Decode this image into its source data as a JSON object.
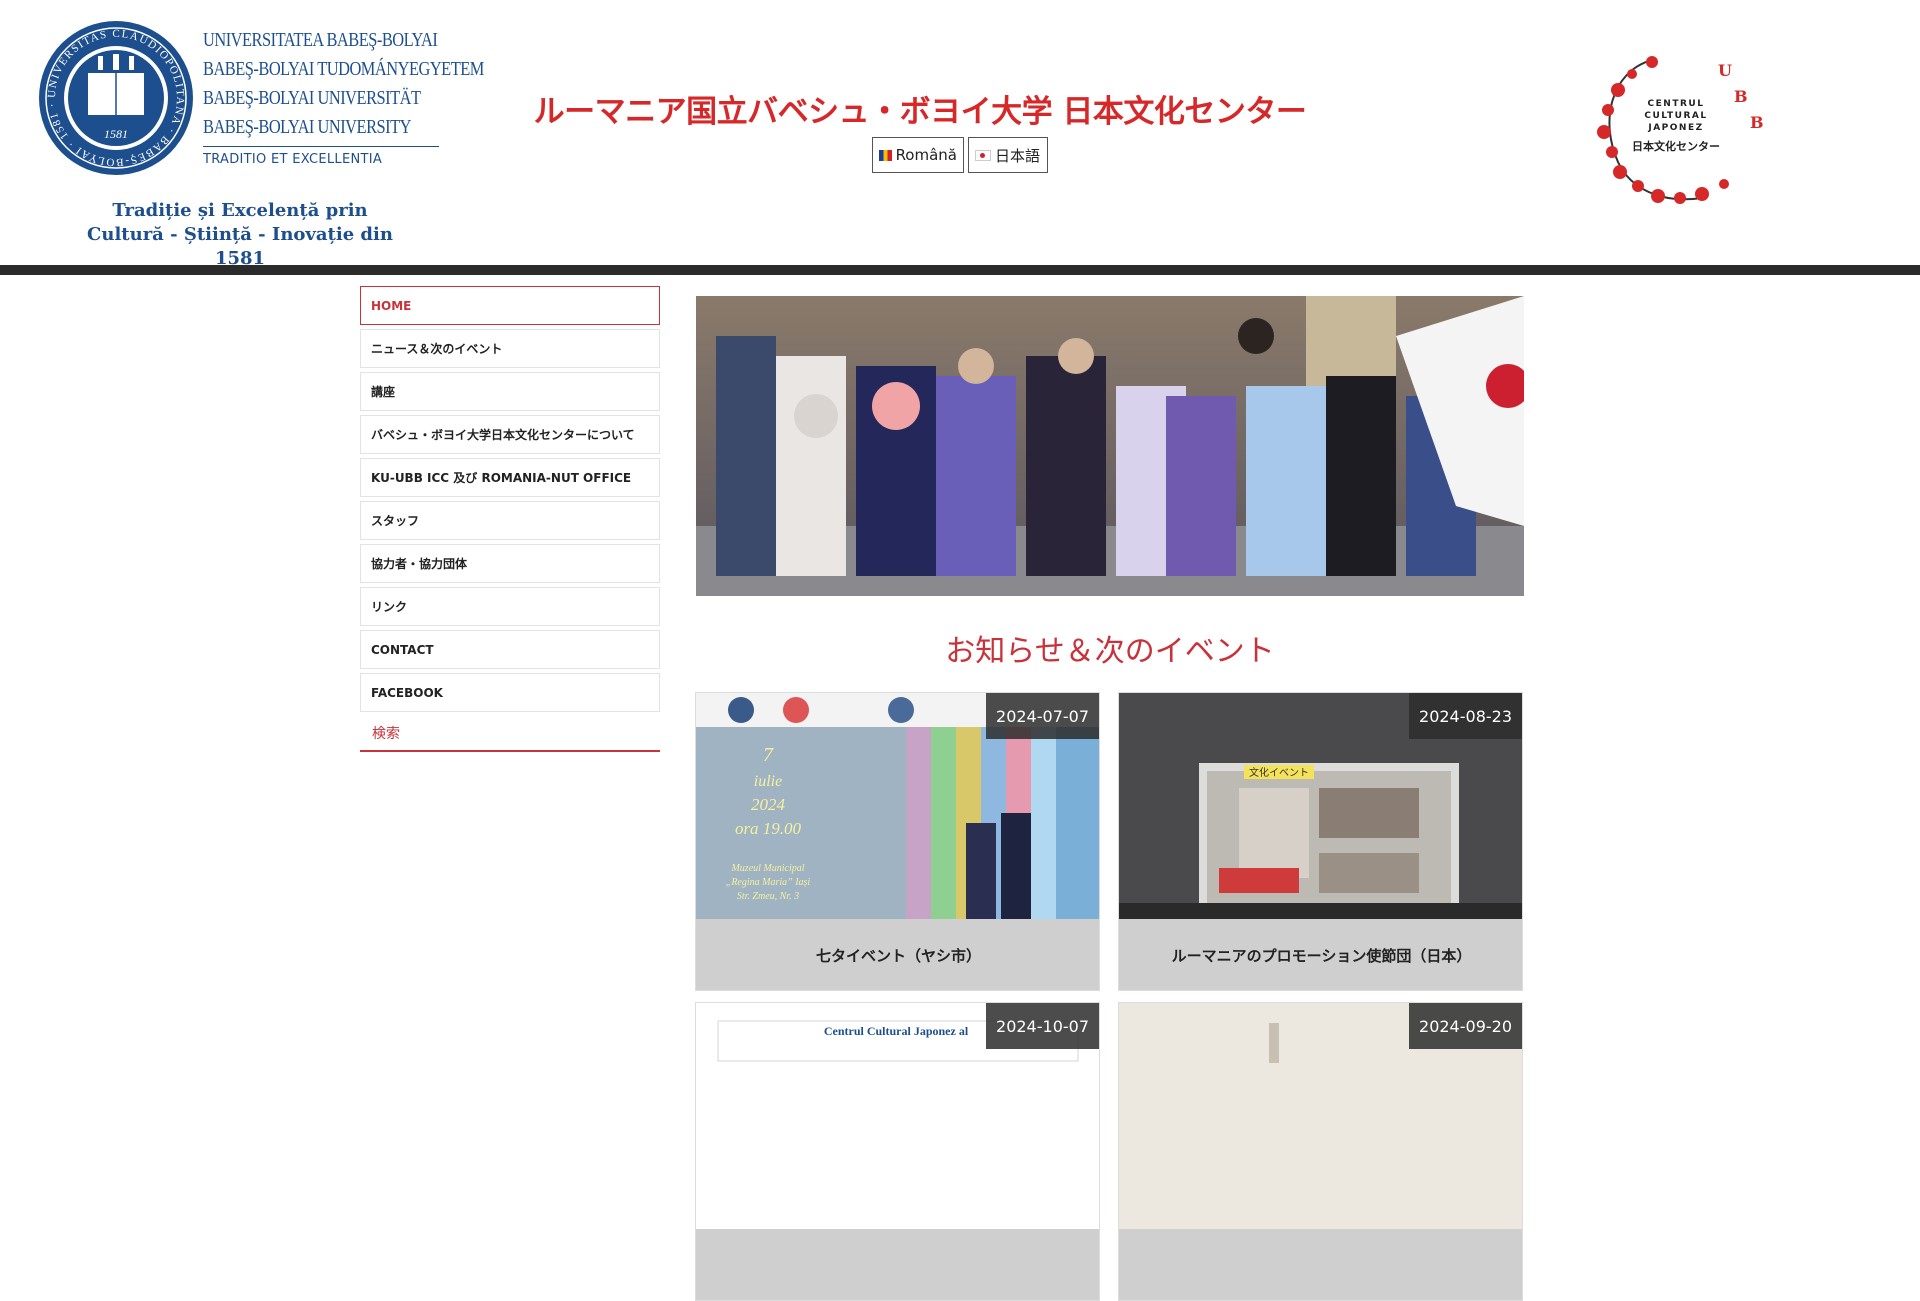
{
  "header": {
    "university_names": [
      "UNIVERSITATEA BABEŞ-BOLYAI",
      "BABEŞ-BOLYAI TUDOMÁNYEGYETEM",
      "BABEŞ-BOLYAI UNIVERSITÄT",
      "BABEŞ-BOLYAI UNIVERSITY"
    ],
    "motto": "TRADITIO ET EXCELLENTIA",
    "seal_text": "UNIVERSITAS CLAUDIOPOLITANA · BABEŞ-BOLYAI · 1581 · ROMÂNIA",
    "tagline_line1": "Tradiție și Excelență prin",
    "tagline_line2": "Cultură - Știință - Inovație din 1581",
    "site_title": "ルーマニア国立バベシュ・ボヨイ大学 日本文化センター",
    "lang_ro": "Română",
    "lang_ja": "日本語",
    "ccj_logo_text": [
      "CENTRUL",
      "CULTURAL",
      "JAPONEZ",
      "日本文化センター"
    ],
    "ccj_letters": [
      "U",
      "B",
      "B"
    ]
  },
  "menu": {
    "items": [
      {
        "label": "HOME"
      },
      {
        "label": "ニュース＆次のイベント"
      },
      {
        "label": "講座"
      },
      {
        "label": "バベシュ・ボヨイ大学日本文化センターについて"
      },
      {
        "label": "KU-UBB ICC 及び ROMANIA-NUT OFFICE"
      },
      {
        "label": "スタッフ"
      },
      {
        "label": "協力者・協力団体"
      },
      {
        "label": "リンク"
      },
      {
        "label": "CONTACT"
      },
      {
        "label": "FACEBOOK"
      }
    ],
    "search_label": "検索"
  },
  "main": {
    "section_title": "お知らせ＆次のイベント",
    "cards": [
      {
        "date": "2024-07-07",
        "caption": "七タイベント（ヤシ市）",
        "poster": [
          "7",
          "iulie",
          "2024",
          "ora 19.00",
          "Muzeul Municipal",
          "„Regina Maria” Iași",
          "Str. Zmeu, Nr. 3"
        ]
      },
      {
        "date": "2024-08-23",
        "caption": "ルーマニアのプロモーション使節団（日本）",
        "screen_label": "文化イベント"
      },
      {
        "date": "2024-10-07",
        "caption": "",
        "poster_title": "Centrul Cultural Japonez al"
      },
      {
        "date": "2024-09-20",
        "caption": ""
      }
    ]
  },
  "colors": {
    "accent_red": "#c8323a",
    "title_red": "#d62828",
    "ubb_blue": "#1d4f8f",
    "divider": "#2b2b2b",
    "card_bg": "#cfcfcf"
  }
}
